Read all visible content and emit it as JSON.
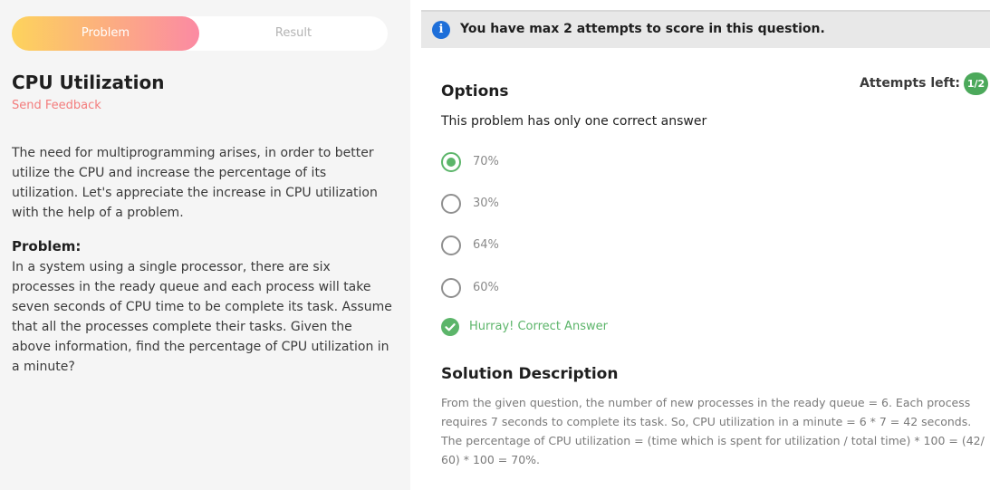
{
  "tabs": {
    "problem": "Problem",
    "result": "Result"
  },
  "question": {
    "title": "CPU Utilization",
    "feedback": "Send Feedback",
    "intro": "The need for multiprogramming arises, in order to better utilize the CPU and increase the percentage of its utilization. Let's appreciate the increase in CPU utilization with the help of a problem.",
    "problem_heading": "Problem:",
    "problem_text": "In a system using a single processor, there are six processes in the ready queue and each process will take seven seconds of CPU time to be complete its task. Assume that all the processes complete their tasks. Given the above information, find the percentage of CPU utilization in a minute?"
  },
  "banner": {
    "icon": "info-icon",
    "text": "You have max 2 attempts to score in this question."
  },
  "options": {
    "heading": "Options",
    "attempts_label": "Attempts left:",
    "attempts_value": "1/2",
    "subtitle": "This problem has only one correct answer",
    "items": [
      {
        "label": "70%",
        "selected": true
      },
      {
        "label": "30%",
        "selected": false
      },
      {
        "label": "64%",
        "selected": false
      },
      {
        "label": "60%",
        "selected": false
      }
    ],
    "feedback": "Hurray! Correct Answer"
  },
  "solution": {
    "heading": "Solution Description",
    "text": "From the given question, the number of new processes in the ready queue = 6. Each process requires 7 seconds to complete its task. So, CPU utilization in a minute = 6 * 7 = 42 seconds. The percentage of CPU utilization =  (time which is spent for utilization / total time) * 100 = (42/ 60) * 100 = 70%."
  },
  "colors": {
    "accent_green": "#5cb56a",
    "feedback_link": "#f47c7c",
    "tab_gradient_start": "#fdd35c",
    "tab_gradient_end": "#fb8aa3",
    "info_blue": "#1e6fd9"
  }
}
